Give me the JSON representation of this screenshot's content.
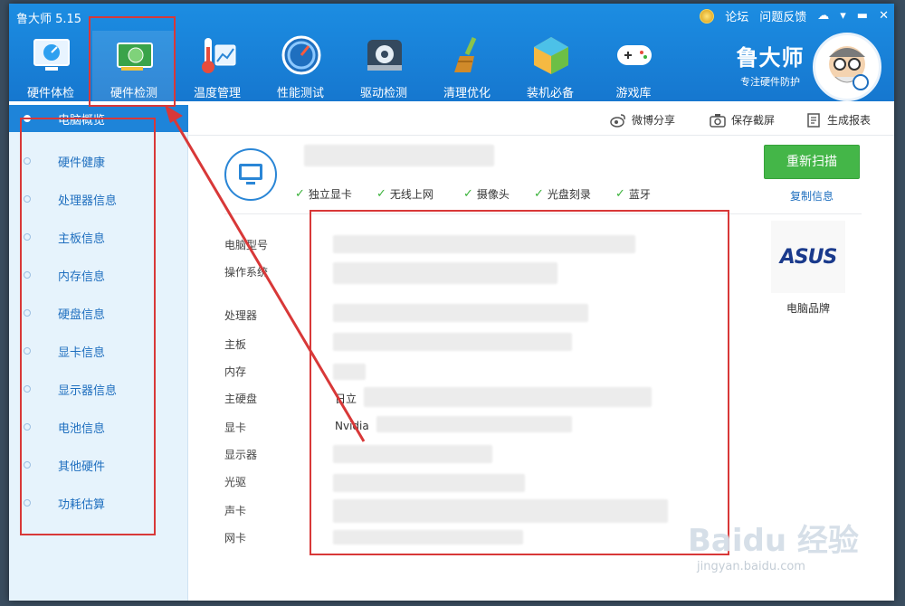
{
  "window": {
    "title": "鲁大师 5.15"
  },
  "titlebar": {
    "forum": "论坛",
    "feedback": "问题反馈",
    "min": "▬",
    "close": "✕"
  },
  "nav": [
    {
      "label": "硬件体检"
    },
    {
      "label": "硬件检测"
    },
    {
      "label": "温度管理"
    },
    {
      "label": "性能测试"
    },
    {
      "label": "驱动检测"
    },
    {
      "label": "清理优化"
    },
    {
      "label": "装机必备"
    },
    {
      "label": "游戏库"
    }
  ],
  "brand": {
    "name": "鲁大师",
    "slogan": "专注硬件防护"
  },
  "sidebar": [
    {
      "label": "电脑概览"
    },
    {
      "label": "硬件健康"
    },
    {
      "label": "处理器信息"
    },
    {
      "label": "主板信息"
    },
    {
      "label": "内存信息"
    },
    {
      "label": "硬盘信息"
    },
    {
      "label": "显卡信息"
    },
    {
      "label": "显示器信息"
    },
    {
      "label": "电池信息"
    },
    {
      "label": "其他硬件"
    },
    {
      "label": "功耗估算"
    }
  ],
  "tools": {
    "share": "微博分享",
    "screenshot": "保存截屏",
    "report": "生成报表"
  },
  "features": [
    {
      "label": "独立显卡"
    },
    {
      "label": "无线上网"
    },
    {
      "label": "摄像头"
    },
    {
      "label": "光盘刻录"
    },
    {
      "label": "蓝牙"
    }
  ],
  "actions": {
    "rescan": "重新扫描",
    "copy": "复制信息"
  },
  "info": {
    "labels": [
      "电脑型号",
      "操作系统",
      "处理器",
      "主板",
      "内存",
      "主硬盘",
      "显卡",
      "显示器",
      "光驱",
      "声卡",
      "网卡"
    ],
    "disk_prefix": "日立",
    "gpu_prefix": "Nvidia"
  },
  "brand_logo": {
    "text": "ASUS",
    "label": "电脑品牌"
  },
  "watermark": {
    "main": "Baidu 经验",
    "sub": "jingyan.baidu.com"
  },
  "colors": {
    "topbar": "#1677cf",
    "active_sidebar": "#1e84d9",
    "rescan": "#44b648",
    "annotation": "#d83838"
  }
}
